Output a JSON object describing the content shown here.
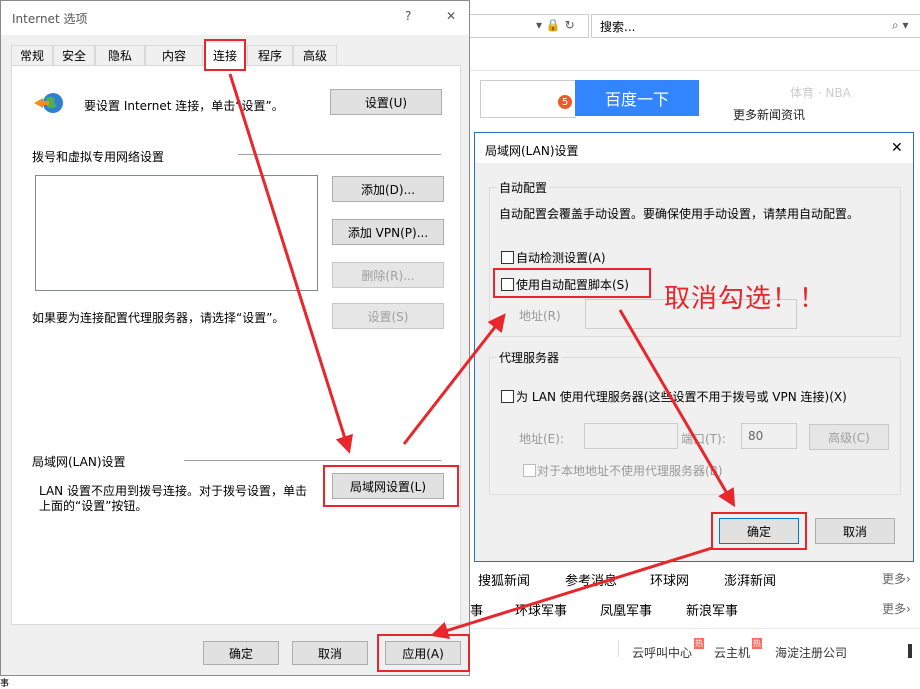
{
  "browser": {
    "address_dropdown": "▾ 🔒 ↻",
    "search_placeholder": "搜索...",
    "search_dropdown": "⌕ ▾",
    "faded_top": "体育 · NBA",
    "badge_count": "5",
    "search_button": "百度一下",
    "more_news": "更多新闻资讯",
    "links_row1": [
      "搜狐新闻",
      "参考消息",
      "环球网",
      "澎湃新闻"
    ],
    "more1": "更多›",
    "links_row2_prefix": "事",
    "links_row2": [
      "环球军事",
      "凤凰军事",
      "新浪军事"
    ],
    "more2": "更多›",
    "bottom_links": [
      "云呼叫中心",
      "云主机",
      "海淀注册公司"
    ],
    "hot_badge": "热",
    "bottom_left_char": "事"
  },
  "ie_dialog": {
    "title": "Internet 选项",
    "help_btn": "?",
    "close_btn": "✕",
    "tabs": [
      "常规",
      "安全",
      "隐私",
      "内容",
      "连接",
      "程序",
      "高级"
    ],
    "setup_text": "要设置 Internet 连接，单击“设置”。",
    "setup_btn": "设置(U)",
    "dialup_section": "拨号和虚拟专用网络设置",
    "add_btn": "添加(D)...",
    "add_vpn_btn": "添加 VPN(P)...",
    "delete_btn": "删除(R)...",
    "proxy_hint": "如果要为连接配置代理服务器，请选择“设置”。",
    "settings_btn": "设置(S)",
    "lan_section": "局域网(LAN)设置",
    "lan_text_line1": "LAN 设置不应用到拨号连接。对于拨号设置，单击",
    "lan_text_line2": "上面的“设置”按钮。",
    "lan_btn": "局域网设置(L)",
    "ok_btn": "确定",
    "cancel_btn": "取消",
    "apply_btn": "应用(A)"
  },
  "lan_dialog": {
    "title": "局域网(LAN)设置",
    "close_btn": "✕",
    "auto_group": "自动配置",
    "auto_desc": "自动配置会覆盖手动设置。要确保使用手动设置，请禁用自动配置。",
    "auto_detect": "自动检测设置(A)",
    "use_script": "使用自动配置脚本(S)",
    "address_label": "地址(R)",
    "proxy_group": "代理服务器",
    "use_proxy": "为 LAN 使用代理服务器(这些设置不用于拨号或 VPN 连接)(X)",
    "proxy_address_label": "地址(E):",
    "port_label": "端口(T):",
    "port_value": "80",
    "advanced_btn": "高级(C)",
    "bypass_local": "对于本地地址不使用代理服务器(B)",
    "ok_btn": "确定",
    "cancel_btn": "取消"
  },
  "annotation": {
    "text": "取消勾选！！"
  },
  "colors": {
    "accent_red": "#e8262b",
    "baidu_blue": "#3385ff",
    "dialog_bg": "#f0f0f0"
  }
}
